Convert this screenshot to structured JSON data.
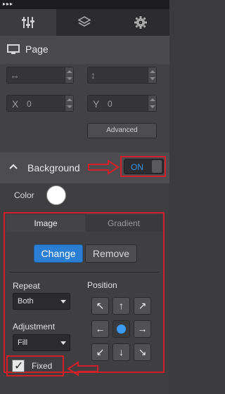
{
  "topbar": {
    "dots": "▸▸▸"
  },
  "tabs": [
    {
      "name": "properties",
      "icon": "sliders-icon",
      "active": true
    },
    {
      "name": "layers",
      "icon": "layers-icon",
      "active": false
    },
    {
      "name": "settings",
      "icon": "gear-icon",
      "active": false
    }
  ],
  "page_section": {
    "title": "Page",
    "width": {
      "value": ""
    },
    "height": {
      "value": ""
    },
    "x": {
      "label": "X",
      "value": "0"
    },
    "y": {
      "label": "Y",
      "value": "0"
    },
    "advanced_label": "Advanced"
  },
  "background_section": {
    "title": "Background",
    "toggle_label": "ON",
    "color_label": "Color",
    "color_value": "#ffffff",
    "tabs": {
      "image": "Image",
      "gradient": "Gradient"
    },
    "change_label": "Change",
    "remove_label": "Remove",
    "repeat_label": "Repeat",
    "repeat_value": "Both",
    "adjustment_label": "Adjustment",
    "adjustment_value": "Fill",
    "position_label": "Position",
    "position_grid": [
      "↖",
      "↑",
      "↗",
      "←",
      "•",
      "→",
      "↙",
      "↓",
      "↘"
    ],
    "fixed_label": "Fixed",
    "fixed_checked": true
  },
  "colors": {
    "accent": "#2a7fd4",
    "annotation_red": "#d2202a",
    "toggle_text": "#3a8fe0"
  }
}
